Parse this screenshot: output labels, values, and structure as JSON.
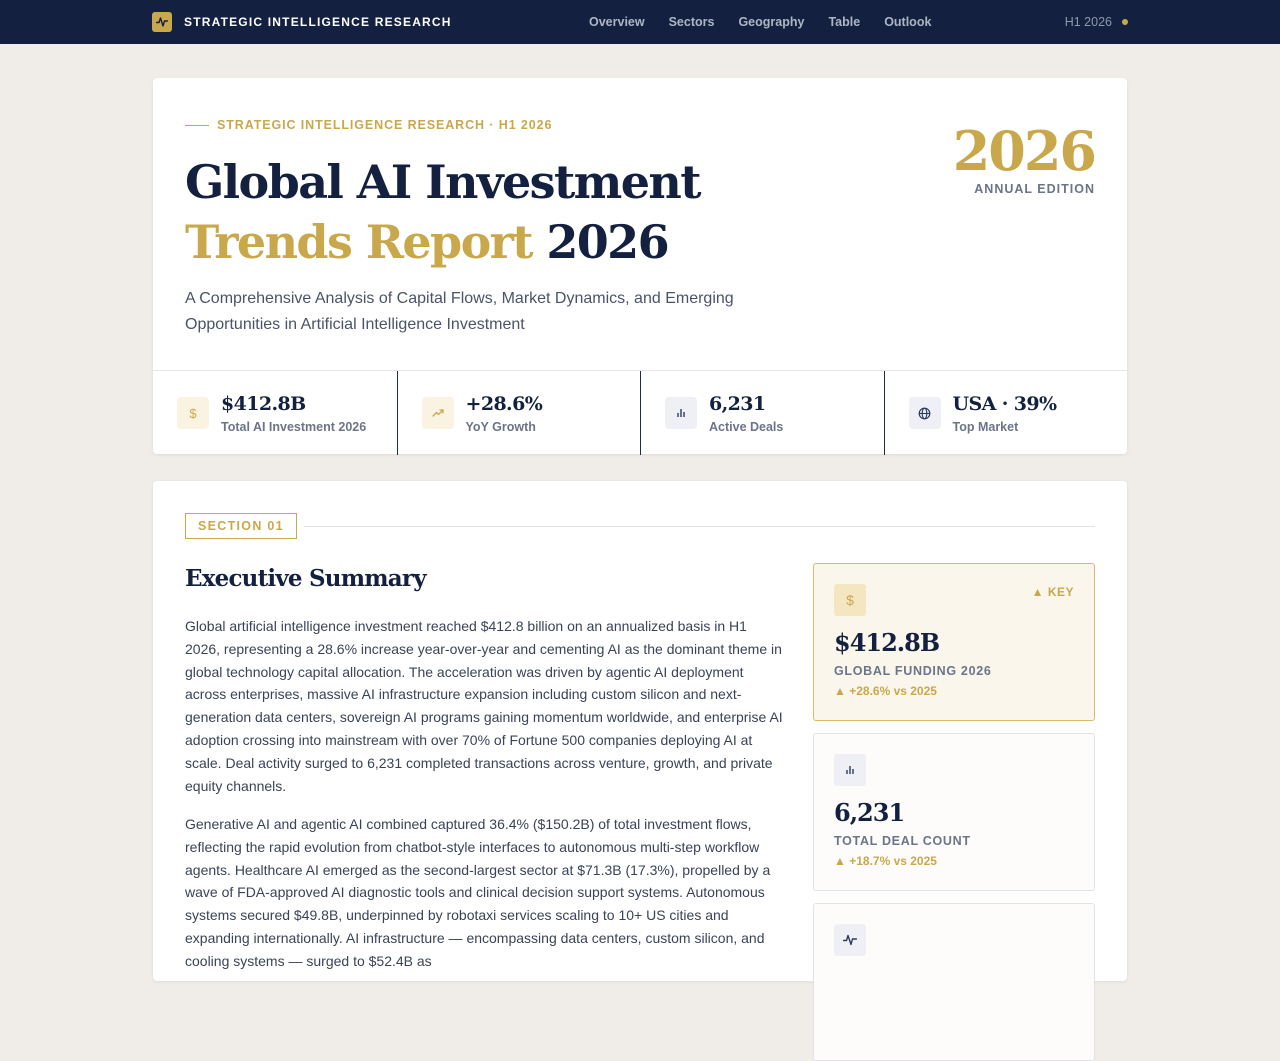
{
  "nav": {
    "brand": "STRATEGIC INTELLIGENCE RESEARCH",
    "items": [
      "Overview",
      "Sectors",
      "Geography",
      "Table",
      "Outlook"
    ],
    "edition": "H1 2026"
  },
  "hero": {
    "eyebrow": "STRATEGIC INTELLIGENCE RESEARCH · H1 2026",
    "title_line1": "Global AI Investment",
    "title_gold": "Trends Report",
    "title_year": "2026",
    "subtitle": "A Comprehensive Analysis of Capital Flows, Market Dynamics, and Emerging Opportunities in Artificial Intelligence Investment",
    "year_big": "2026",
    "year_sub": "ANNUAL EDITION"
  },
  "stats": [
    {
      "value": "$412.8B",
      "label": "Total AI Investment 2026",
      "icon": "dollar-icon"
    },
    {
      "value": "+28.6%",
      "label": "YoY Growth",
      "icon": "trending-up-icon"
    },
    {
      "value": "6,231",
      "label": "Active Deals",
      "icon": "bar-chart-icon"
    },
    {
      "value": "USA · 39%",
      "label": "Top Market",
      "icon": "globe-icon"
    }
  ],
  "section": {
    "badge": "SECTION 01",
    "title": "Executive Summary",
    "p1": "Global artificial intelligence investment reached $412.8 billion on an annualized basis in H1 2026, representing a 28.6% increase year-over-year and cementing AI as the dominant theme in global technology capital allocation. The acceleration was driven by agentic AI deployment across enterprises, massive AI infrastructure expansion including custom silicon and next-generation data centers, sovereign AI programs gaining momentum worldwide, and enterprise AI adoption crossing into mainstream with over 70% of Fortune 500 companies deploying AI at scale. Deal activity surged to 6,231 completed transactions across venture, growth, and private equity channels.",
    "p2": "Generative AI and agentic AI combined captured 36.4% ($150.2B) of total investment flows, reflecting the rapid evolution from chatbot-style interfaces to autonomous multi-step workflow agents. Healthcare AI emerged as the second-largest sector at $71.3B (17.3%), propelled by a wave of FDA-approved AI diagnostic tools and clinical decision support systems. Autonomous systems secured $49.8B, underpinned by robotaxi services scaling to 10+ US cities and expanding internationally. AI infrastructure — encompassing data centers, custom silicon, and cooling systems — surged to $52.4B as"
  },
  "key_cards": [
    {
      "value": "$412.8B",
      "label": "GLOBAL FUNDING 2026",
      "delta": "▲ +28.6% vs 2025",
      "flag": "▲ KEY",
      "icon": "dollar-icon"
    },
    {
      "value": "6,231",
      "label": "TOTAL DEAL COUNT",
      "delta": "▲ +18.7% vs 2025",
      "icon": "bar-chart-icon"
    },
    {
      "icon": "activity-icon"
    }
  ],
  "colors": {
    "navy": "#13203f",
    "gold": "#c9a84c",
    "page_bg": "#f0ede8"
  }
}
